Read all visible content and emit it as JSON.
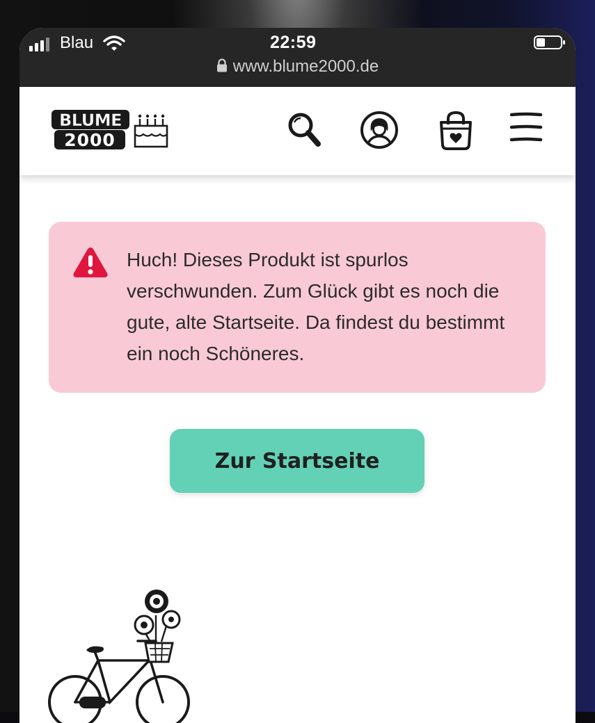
{
  "status_bar": {
    "carrier": "Blau",
    "time": "22:59",
    "url": "www.blume2000.de"
  },
  "header": {
    "logo": {
      "line1": "BLUME",
      "line2": "2000"
    },
    "icons": [
      "search-icon",
      "account-icon",
      "cart-icon",
      "menu-icon"
    ]
  },
  "alert": {
    "icon": "warning-icon",
    "color": "#f9cad6",
    "icon_color": "#e0163f",
    "message": "Huch! Dieses Produkt ist spurlos verschwunden. Zum Glück gibt es noch die gute, alte Startseite. Da findest du bestimmt ein noch Schöneres."
  },
  "button": {
    "label": "Zur Startseite",
    "color": "#63d1b5"
  },
  "illustration": "bicycle-with-flowers"
}
